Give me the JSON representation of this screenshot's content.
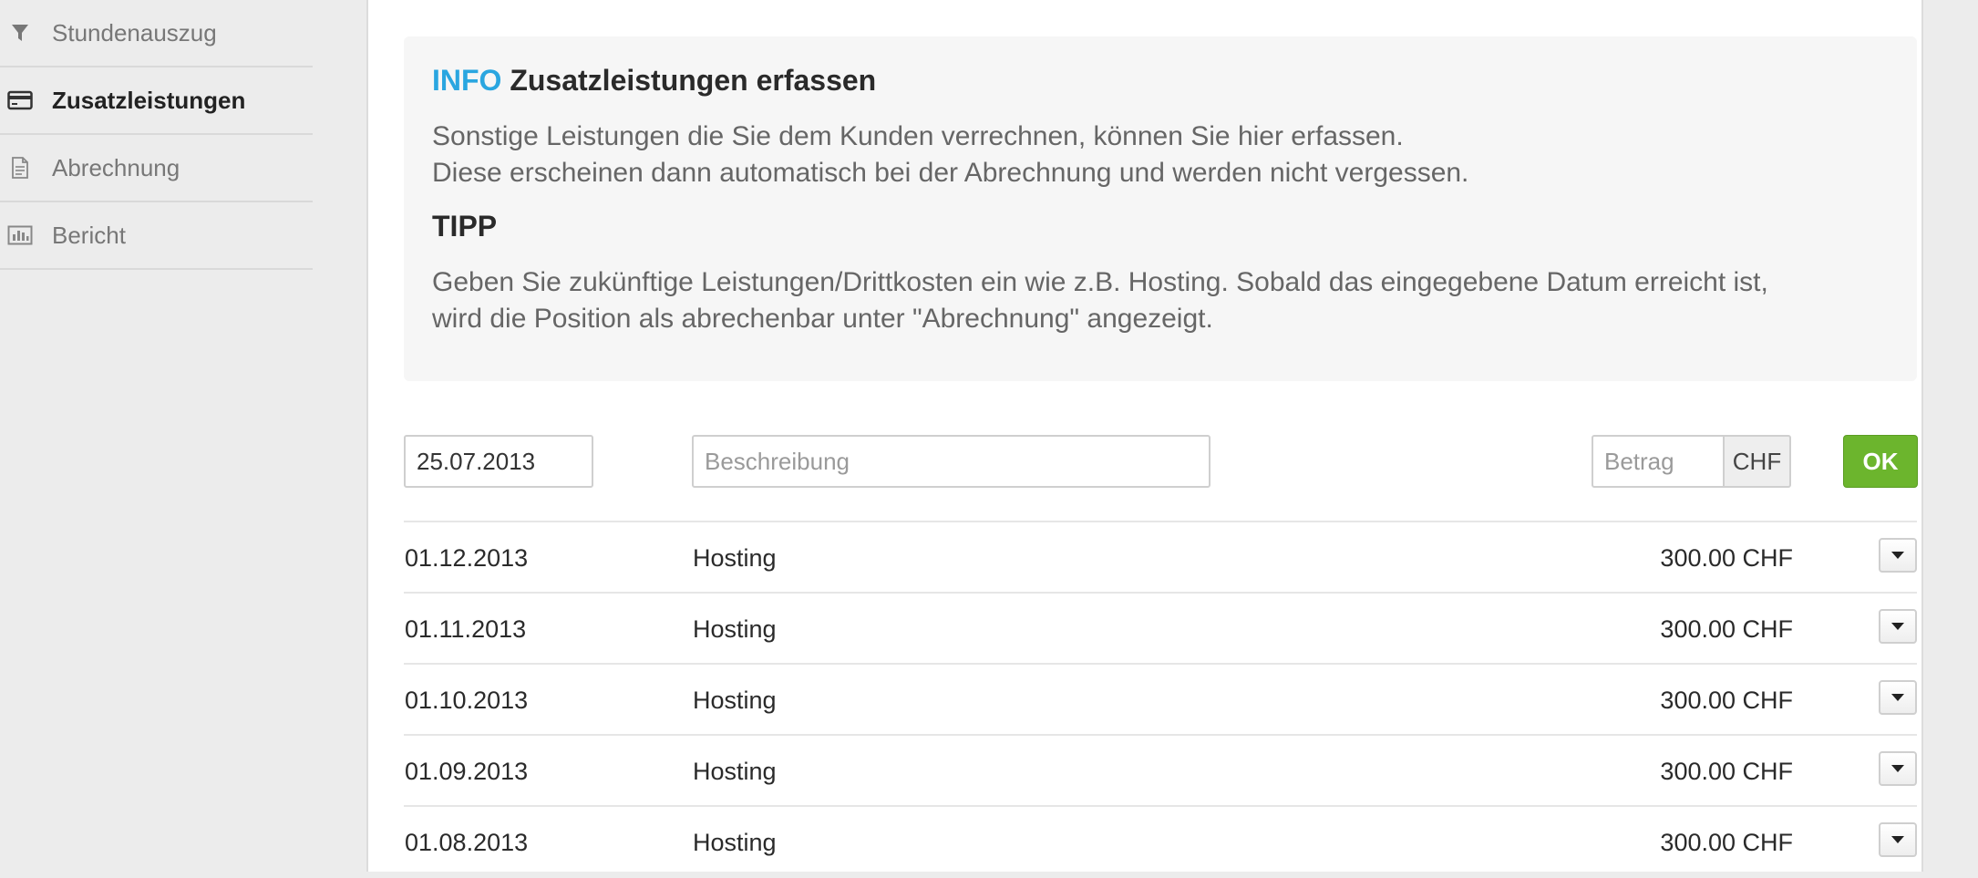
{
  "sidebar": {
    "items": [
      {
        "label": "Stundenauszug",
        "icon": "filter-icon"
      },
      {
        "label": "Zusatzleistungen",
        "icon": "credit-card-icon",
        "active": true
      },
      {
        "label": "Abrechnung",
        "icon": "document-icon"
      },
      {
        "label": "Bericht",
        "icon": "bar-chart-icon"
      }
    ]
  },
  "info": {
    "tag": "INFO",
    "title": "Zusatzleistungen erfassen",
    "line1": "Sonstige Leistungen die Sie dem Kunden verrechnen, können Sie hier erfassen.",
    "line2": "Diese erscheinen dann automatisch bei der Abrechnung und werden nicht vergessen.",
    "tipp_title": "TIPP",
    "tipp_line1": "Geben Sie zukünftige Leistungen/Drittkosten ein wie z.B. Hosting. Sobald das eingegebene Datum erreicht ist,",
    "tipp_line2": "wird die Position als abrechenbar unter \"Abrechnung\" angezeigt."
  },
  "form": {
    "date_value": "25.07.2013",
    "description_placeholder": "Beschreibung",
    "amount_placeholder": "Betrag",
    "currency": "CHF",
    "ok_label": "OK"
  },
  "entries": [
    {
      "date": "01.12.2013",
      "description": "Hosting",
      "amount": "300.00 CHF"
    },
    {
      "date": "01.11.2013",
      "description": "Hosting",
      "amount": "300.00 CHF"
    },
    {
      "date": "01.10.2013",
      "description": "Hosting",
      "amount": "300.00 CHF"
    },
    {
      "date": "01.09.2013",
      "description": "Hosting",
      "amount": "300.00 CHF"
    },
    {
      "date": "01.08.2013",
      "description": "Hosting",
      "amount": "300.00 CHF"
    }
  ],
  "colors": {
    "accent_info": "#2aa6e0",
    "ok_button": "#6cb52d"
  }
}
